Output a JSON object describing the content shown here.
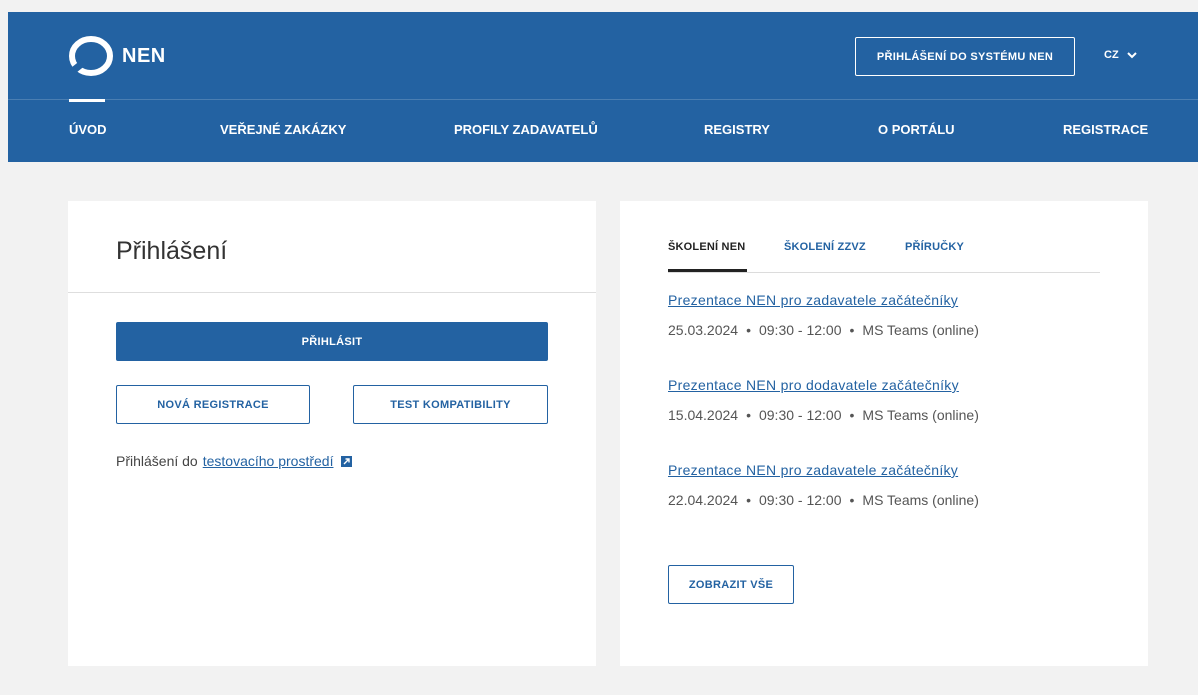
{
  "header": {
    "logo_text": "NEN",
    "login_button": "PŘIHLÁŠENÍ DO SYSTÉMU NEN",
    "language": "CZ"
  },
  "nav": [
    {
      "label": "ÚVOD",
      "active": true
    },
    {
      "label": "VEŘEJNÉ ZAKÁZKY",
      "active": false
    },
    {
      "label": "PROFILY ZADAVATELŮ",
      "active": false
    },
    {
      "label": "REGISTRY",
      "active": false
    },
    {
      "label": "O PORTÁLU",
      "active": false
    },
    {
      "label": "REGISTRACE",
      "active": false
    }
  ],
  "login_card": {
    "title": "Přihlášení",
    "login_button": "PŘIHLÁSIT",
    "new_registration_button": "NOVÁ REGISTRACE",
    "compat_test_button": "TEST KOMPATIBILITY",
    "test_env_prefix": "Přihlášení do",
    "test_env_link": "testovacího prostředí"
  },
  "training_card": {
    "tabs": [
      {
        "label": "ŠKOLENÍ NEN",
        "active": true
      },
      {
        "label": "ŠKOLENÍ ZZVZ",
        "active": false
      },
      {
        "label": "PŘÍRUČKY",
        "active": false
      }
    ],
    "events": [
      {
        "title": "Prezentace NEN pro zadavatele začátečníky",
        "date": "25.03.2024",
        "time": "09:30 - 12:00",
        "place": "MS Teams (online)"
      },
      {
        "title": "Prezentace NEN pro dodavatele začátečníky",
        "date": "15.04.2024",
        "time": "09:30 - 12:00",
        "place": "MS Teams (online)"
      },
      {
        "title": "Prezentace NEN pro zadavatele začátečníky",
        "date": "22.04.2024",
        "time": "09:30 - 12:00",
        "place": "MS Teams (online)"
      }
    ],
    "dot": "•",
    "show_all_button": "ZOBRAZIT VŠE"
  },
  "colors": {
    "brand": "#2362a2",
    "background": "#f2f2f2"
  }
}
